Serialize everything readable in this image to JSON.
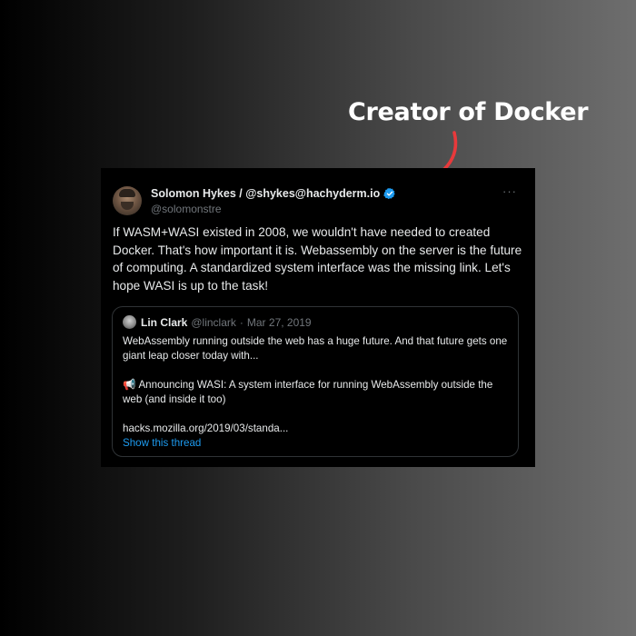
{
  "annotation": {
    "text": "Creator of Docker",
    "arrow_color": "#e8393b"
  },
  "tweet": {
    "author_name": "Solomon Hykes / @shykes@hachyderm.io",
    "author_handle": "@solomonstre",
    "more_label": "···",
    "text": "If WASM+WASI existed in 2008, we wouldn't have needed to created Docker. That's how important it is. Webassembly on the server is the future of computing. A standardized system interface was the missing link. Let's hope WASI is up to the task!",
    "verified_color": "#1d9bf0"
  },
  "quote": {
    "author_name": "Lin Clark",
    "author_handle": "@linclark",
    "separator": "·",
    "date": "Mar 27, 2019",
    "paragraph1": "WebAssembly running outside the web has a huge future. And that future gets one giant leap closer today with...",
    "megaphone_icon": "📢",
    "paragraph2": "Announcing WASI: A system interface for running WebAssembly outside the web (and inside it too)",
    "link": "hacks.mozilla.org/2019/03/standa...",
    "show_thread": "Show this thread",
    "link_color": "#1d9bf0"
  }
}
